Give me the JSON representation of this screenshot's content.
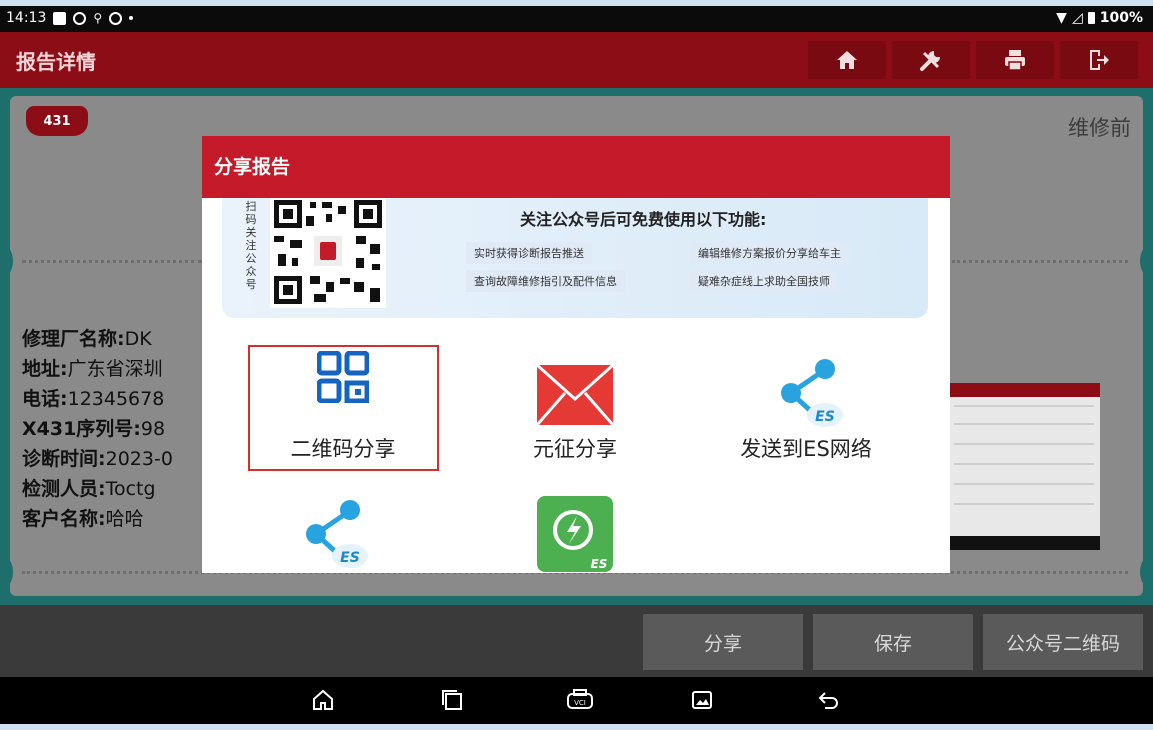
{
  "status_bar": {
    "time": "14:13",
    "battery": "100%"
  },
  "title_bar": {
    "title": "报告详情",
    "buttons": [
      "home-icon",
      "tools-icon",
      "printer-icon",
      "exit-icon"
    ]
  },
  "report": {
    "badge": "431",
    "corner_label": "维修前",
    "info": [
      {
        "label": "修理厂名称:",
        "value": "DK"
      },
      {
        "label": "地址:",
        "value": "广东省深圳"
      },
      {
        "label": "电话:",
        "value": "12345678"
      },
      {
        "label": "X431序列号:",
        "value": "98"
      },
      {
        "label": "诊断时间:",
        "value": "2023-0"
      },
      {
        "label": "检测人员:",
        "value": "Toctg"
      },
      {
        "label": "客户名称:",
        "value": "哈哈"
      }
    ]
  },
  "dialog": {
    "title": "分享报告",
    "banner": {
      "scan_label": "扫码关注公众号",
      "title": "关注公众号后可免费使用以下功能:",
      "features": [
        "实时获得诊断报告推送",
        "编辑维修方案报价分享给车主",
        "查询故障维修指引及配件信息",
        "疑难杂症线上求助全国技师"
      ]
    },
    "items": [
      {
        "label": "二维码分享",
        "icon": "qr-code-icon"
      },
      {
        "label": "元征分享",
        "icon": "mail-icon"
      },
      {
        "label": "发送到ES网络",
        "icon": "es-share-icon"
      },
      {
        "label": "",
        "icon": "es-share-icon"
      },
      {
        "label": "",
        "icon": "es-sync-icon"
      }
    ]
  },
  "bottom_bar": {
    "share": "分享",
    "save": "保存",
    "qr_code": "公众号二维码"
  },
  "colors": {
    "title_bar": "#8c0d16",
    "dialog_header": "#c41a29",
    "content_bg": "#1e6f6b",
    "highlight": "#d32f2f"
  }
}
